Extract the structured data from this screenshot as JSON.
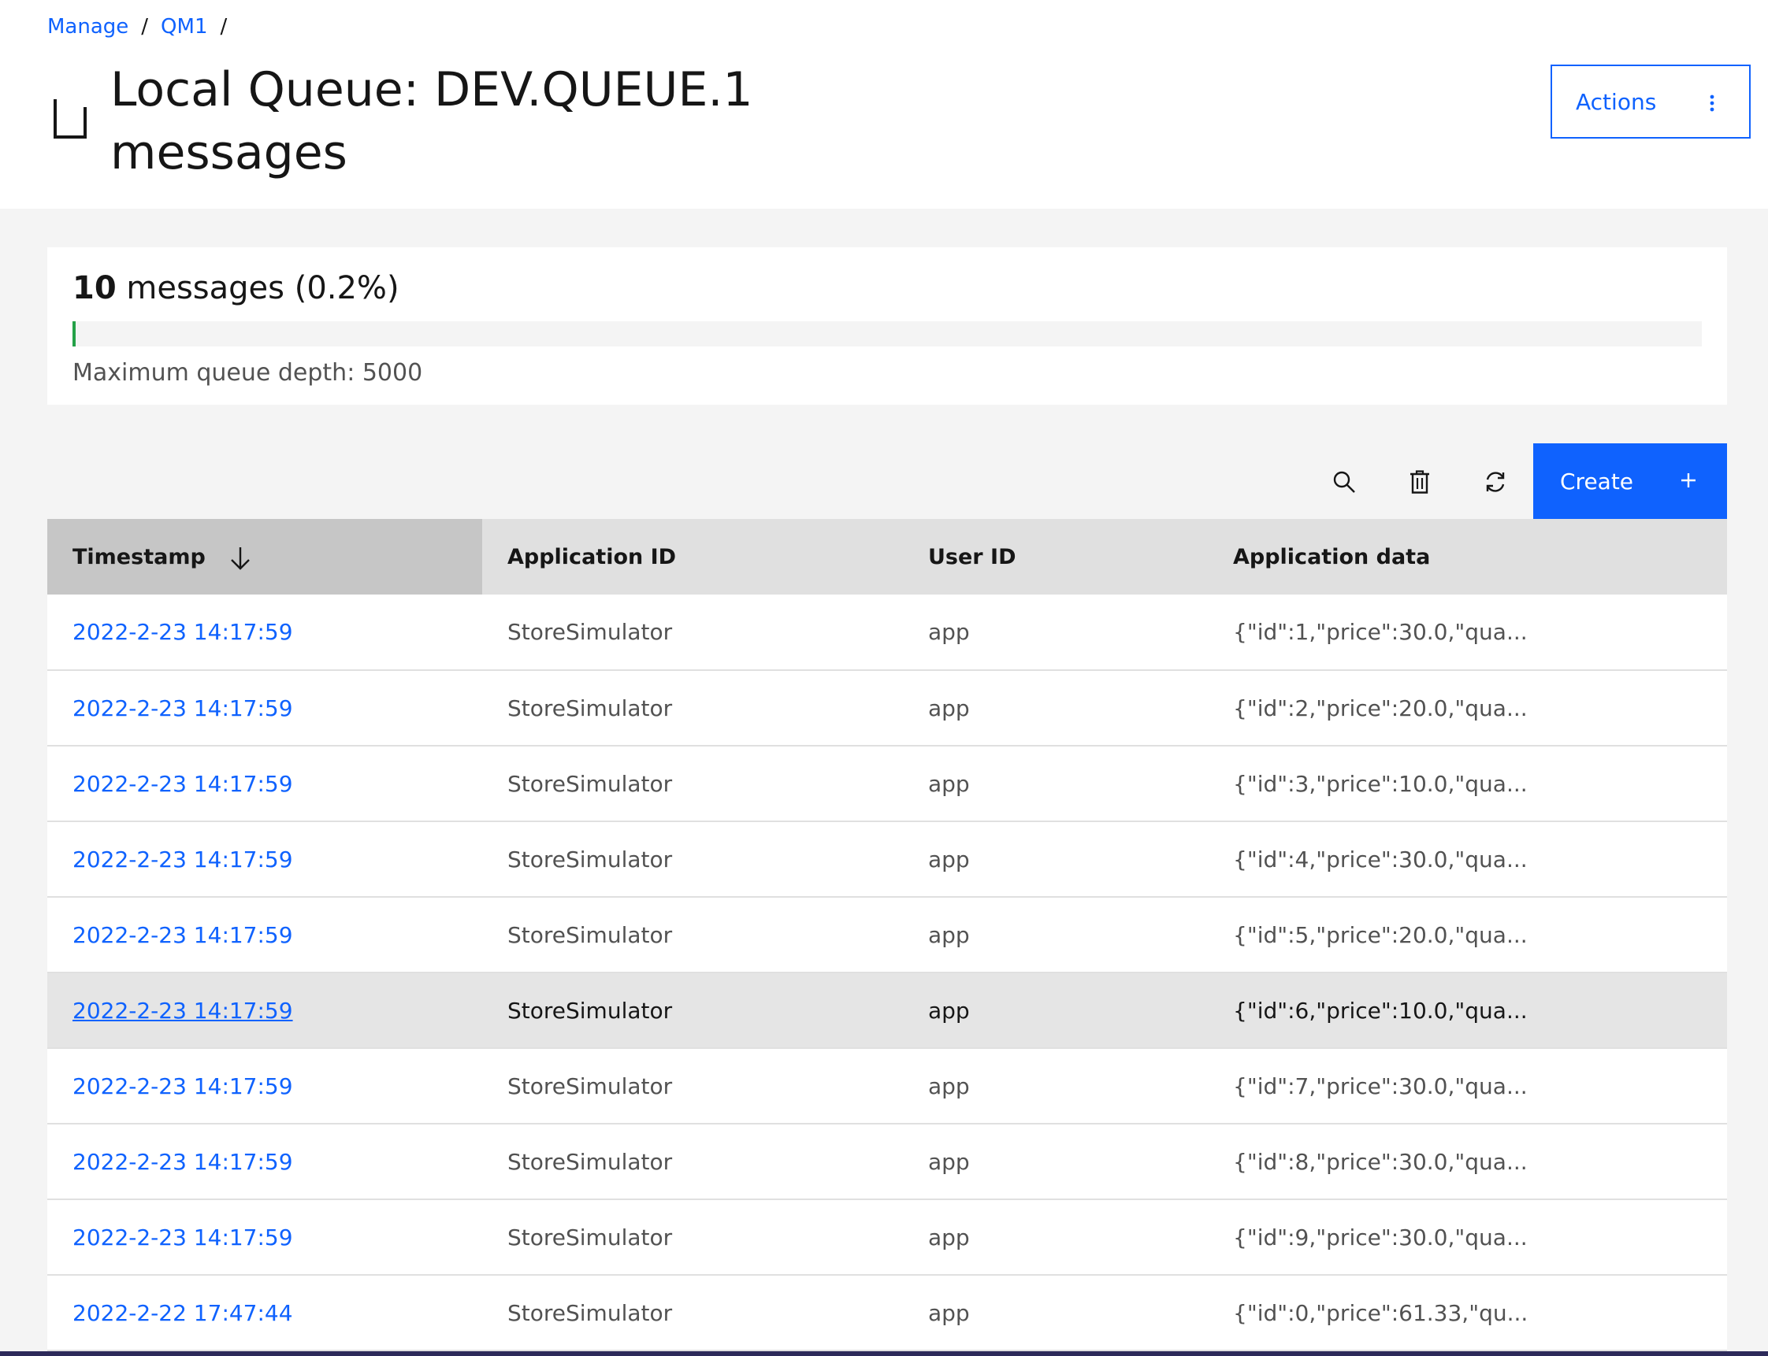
{
  "breadcrumb": {
    "items": [
      "Manage",
      "QM1"
    ],
    "separator": "/"
  },
  "page": {
    "title_line1": "Local Queue: DEV.QUEUE.1",
    "title_line2": "messages",
    "icon": "queue-icon"
  },
  "actions": {
    "label": "Actions",
    "icon": "overflow-menu-vertical-icon"
  },
  "depth": {
    "count": "10",
    "count_suffix": "messages (0.2%)",
    "fill_percent": 0.2,
    "max_label": "Maximum queue depth: 5000",
    "bar_color": "#24a148"
  },
  "toolbar": {
    "icons": [
      "search-icon",
      "trash-icon",
      "refresh-icon"
    ],
    "create_label": "Create",
    "create_icon": "plus-icon"
  },
  "colors": {
    "accent": "#0f62fe",
    "header_bg": "#e0e0e0",
    "sorted_header_bg": "#c6c6c6",
    "hover_row": "#e5e5e5"
  },
  "table": {
    "columns": [
      "Timestamp",
      "Application ID",
      "User ID",
      "Application data"
    ],
    "sort_icon": "arrow-down-icon",
    "rows": [
      {
        "timestamp": "2022-2-23 14:17:59",
        "app_id": "StoreSimulator",
        "user_id": "app",
        "data": "{\"id\":1,\"price\":30.0,\"qua..."
      },
      {
        "timestamp": "2022-2-23 14:17:59",
        "app_id": "StoreSimulator",
        "user_id": "app",
        "data": "{\"id\":2,\"price\":20.0,\"qua..."
      },
      {
        "timestamp": "2022-2-23 14:17:59",
        "app_id": "StoreSimulator",
        "user_id": "app",
        "data": "{\"id\":3,\"price\":10.0,\"qua..."
      },
      {
        "timestamp": "2022-2-23 14:17:59",
        "app_id": "StoreSimulator",
        "user_id": "app",
        "data": "{\"id\":4,\"price\":30.0,\"qua..."
      },
      {
        "timestamp": "2022-2-23 14:17:59",
        "app_id": "StoreSimulator",
        "user_id": "app",
        "data": "{\"id\":5,\"price\":20.0,\"qua..."
      },
      {
        "timestamp": "2022-2-23 14:17:59",
        "app_id": "StoreSimulator",
        "user_id": "app",
        "data": "{\"id\":6,\"price\":10.0,\"qua..."
      },
      {
        "timestamp": "2022-2-23 14:17:59",
        "app_id": "StoreSimulator",
        "user_id": "app",
        "data": "{\"id\":7,\"price\":30.0,\"qua..."
      },
      {
        "timestamp": "2022-2-23 14:17:59",
        "app_id": "StoreSimulator",
        "user_id": "app",
        "data": "{\"id\":8,\"price\":30.0,\"qua..."
      },
      {
        "timestamp": "2022-2-23 14:17:59",
        "app_id": "StoreSimulator",
        "user_id": "app",
        "data": "{\"id\":9,\"price\":30.0,\"qua..."
      },
      {
        "timestamp": "2022-2-22 17:47:44",
        "app_id": "StoreSimulator",
        "user_id": "app",
        "data": "{\"id\":0,\"price\":61.33,\"qu..."
      }
    ]
  }
}
